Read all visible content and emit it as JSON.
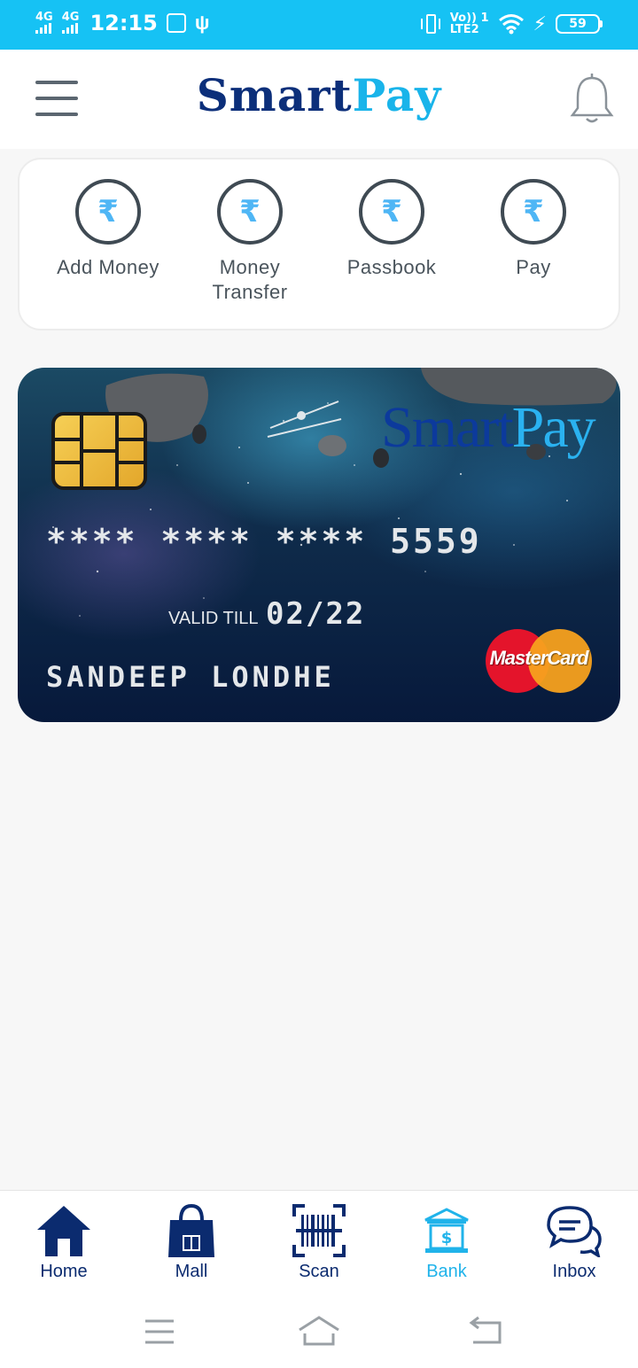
{
  "status_bar": {
    "network1": "4G",
    "network2": "4G",
    "time": "12:15",
    "volte_line1": "Vo)) 1",
    "volte_line2": "LTE2",
    "battery": "59"
  },
  "header": {
    "logo_part1": "Smart",
    "logo_part2": "Pay",
    "menu_icon": "hamburger-menu-icon",
    "bell_icon": "bell-icon"
  },
  "quick_actions": [
    {
      "label": "Add Money",
      "icon": "rupee-icon"
    },
    {
      "label": "Money Transfer",
      "icon": "rupee-icon"
    },
    {
      "label": "Passbook",
      "icon": "rupee-icon"
    },
    {
      "label": "Pay",
      "icon": "rupee-icon"
    }
  ],
  "rupee_symbol": "₹",
  "card": {
    "logo_part1": "Smart",
    "logo_part2": "Pay",
    "number": "**** **** **** 5559",
    "valid_label": "VALID TILL",
    "valid_value": "02/22",
    "holder": "SANDEEP LONDHE",
    "network": "MasterCard"
  },
  "bottom_nav": [
    {
      "label": "Home",
      "icon": "home-icon",
      "active": false
    },
    {
      "label": "Mall",
      "icon": "shopping-bag-icon",
      "active": false
    },
    {
      "label": "Scan",
      "icon": "barcode-scan-icon",
      "active": false
    },
    {
      "label": "Bank",
      "icon": "bank-icon",
      "active": true
    },
    {
      "label": "Inbox",
      "icon": "chat-icon",
      "active": false
    }
  ],
  "colors": {
    "status_bar": "#16c2f4",
    "brand_dark": "#0c2f7a",
    "brand_light": "#19b4ea",
    "nav_text": "#0b2b6f",
    "nav_active": "#20b3ea"
  }
}
